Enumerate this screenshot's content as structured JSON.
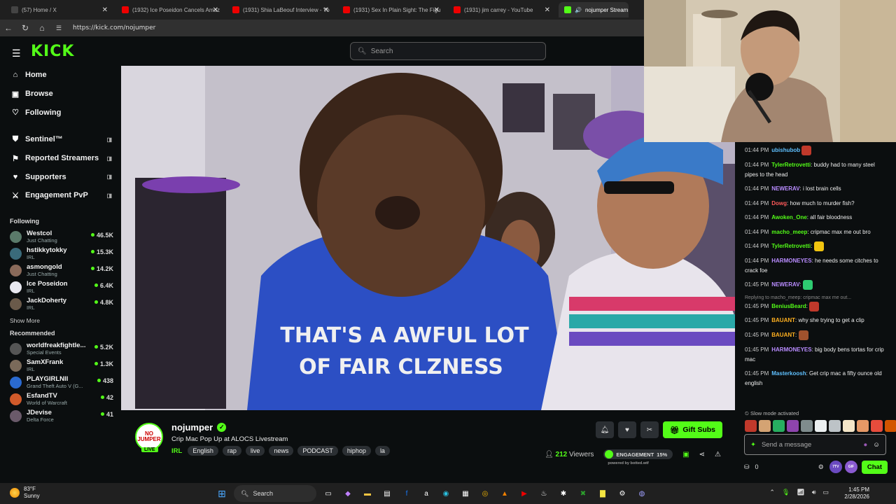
{
  "browser": {
    "tabs": [
      {
        "label": "(57) Home / X",
        "color": "#444"
      },
      {
        "label": "(1932) Ice Poseidon Cancels Amaz",
        "color": "#e00"
      },
      {
        "label": "(1931) Shia LaBeouf Interview - Yo",
        "color": "#e00"
      },
      {
        "label": "(1931) Sex In Plain Sight: The Figu",
        "color": "#e00"
      },
      {
        "label": "(1931) jim carrey - YouTube",
        "color": "#e00"
      }
    ],
    "active_tab": "nojumper Stream",
    "url": "https://kick.com/nojumper"
  },
  "header": {
    "logo": "KICK",
    "search_placeholder": "Search"
  },
  "sidebar": {
    "nav": [
      {
        "label": "Home",
        "icon": "⌂"
      },
      {
        "label": "Browse",
        "icon": "▣"
      },
      {
        "label": "Following",
        "icon": "♡"
      }
    ],
    "extras": [
      {
        "label": "Sentinel™",
        "icon": "⛊"
      },
      {
        "label": "Reported Streamers",
        "icon": "⚑"
      },
      {
        "label": "Supporters",
        "icon": "♥"
      },
      {
        "label": "Engagement PvP",
        "icon": "⚔"
      }
    ],
    "following_title": "Following",
    "following": [
      {
        "name": "Westcol",
        "category": "Just Chatting",
        "viewers": "46.5K",
        "color": "#5a7a6a"
      },
      {
        "name": "hstikkytokky",
        "category": "IRL",
        "viewers": "15.3K",
        "color": "#3a6a7a"
      },
      {
        "name": "asmongold",
        "category": "Just Chatting",
        "viewers": "14.2K",
        "color": "#8a6a5a"
      },
      {
        "name": "Ice Poseidon",
        "category": "IRL",
        "viewers": "6.4K",
        "color": "#e8e8f0"
      },
      {
        "name": "JackDoherty",
        "category": "IRL",
        "viewers": "4.8K",
        "color": "#6a5a4a"
      }
    ],
    "show_more": "Show More",
    "recommended_title": "Recommended",
    "recommended": [
      {
        "name": "worldfreakfightle...",
        "category": "Special Events",
        "viewers": "5.2K",
        "color": "#555"
      },
      {
        "name": "SamXFrank",
        "category": "IRL",
        "viewers": "1.3K",
        "color": "#7a6a5a"
      },
      {
        "name": "PLAYGIRLNII",
        "category": "Grand Theft Auto V (G...",
        "viewers": "438",
        "color": "#2a6ad0"
      },
      {
        "name": "EsfandTV",
        "category": "World of Warcraft",
        "viewers": "42",
        "color": "#d05a2a"
      },
      {
        "name": "JDevise",
        "category": "Delta Force",
        "viewers": "41",
        "color": "#6a5a6a"
      }
    ]
  },
  "stream": {
    "channel": "nojumper",
    "avatar_text": "NO JUMPER",
    "live": "LIVE",
    "title": "Crip Mac Pop Up at ALOCS Livestream",
    "category": "IRL",
    "tags": [
      "English",
      "rap",
      "live",
      "news",
      "PODCAST",
      "hiphop",
      "la"
    ],
    "gift_label": "Gift Subs",
    "viewers": "212",
    "viewers_label": "Viewers",
    "engagement_label": "ENGAGEMENT",
    "engagement_value": "15%",
    "engagement_fraction": 0.15,
    "powered_by": "powered by botted.wtf",
    "shirt_text_1": "THAT'S A AWFUL LOT",
    "shirt_text_2": "OF FAIR CLZNESS"
  },
  "chat": {
    "messages": [
      {
        "time": "01:44 PM",
        "user": "ubishubob",
        "text": "",
        "color": "#5fc0ff",
        "emote": "#c0392b"
      },
      {
        "time": "01:44 PM",
        "user": "TylerRetrovetti",
        "text": ": buddy had to many steel pipes to the head",
        "color": "#53fc18"
      },
      {
        "time": "01:44 PM",
        "user": "NEWERAV",
        "text": ": i lost brain cells",
        "color": "#b98cff"
      },
      {
        "time": "01:44 PM",
        "user": "Dowg",
        "text": ": how much to murder fish?",
        "color": "#ff5a5a"
      },
      {
        "time": "01:44 PM",
        "user": "Awoken_One",
        "text": ": all fair bloodness",
        "color": "#53fc18"
      },
      {
        "time": "01:44 PM",
        "user": "macho_meep",
        "text": ": cripmac max me out bro",
        "color": "#53fc18"
      },
      {
        "time": "01:44 PM",
        "user": "TylerRetrovetti",
        "text": ":",
        "color": "#53fc18",
        "emote": "#f1c40f"
      },
      {
        "time": "01:44 PM",
        "user": "HARMONEYES",
        "text": ": he needs some citches to crack foe",
        "color": "#b98cff"
      },
      {
        "time": "01:45 PM",
        "user": "NEWERAV",
        "text": ":",
        "color": "#b98cff",
        "emote": "#2ecc71"
      },
      {
        "time": "01:45 PM",
        "user": "BeniusBeard",
        "text": ":",
        "color": "#53fc18",
        "emote": "#c0392b",
        "reply": "Replying to macho_meep: cripmac max me out..."
      },
      {
        "time": "01:45 PM",
        "user": "BAUANT",
        "text": ": why she trying to get a clip",
        "color": "#ffb020"
      },
      {
        "time": "01:45 PM",
        "user": "BAUANT",
        "text": ":",
        "color": "#ffb020",
        "emote": "#a0522d"
      },
      {
        "time": "01:45 PM",
        "user": "HARMONEYES",
        "text": ": big body bens tortas for crip mac",
        "color": "#b98cff"
      },
      {
        "time": "01:45 PM",
        "user": "Masterkoosh",
        "text": ": Get crip mac a fifty ounce old english",
        "color": "#5fc0ff"
      }
    ],
    "slow_mode": "Slow mode activated",
    "input_placeholder": "Send a message",
    "points": "0",
    "chat_button": "Chat",
    "badge_1": "7TV",
    "badge_2": "GIF"
  },
  "taskbar": {
    "temp": "83°F",
    "condition": "Sunny",
    "search": "Search",
    "time": "1:45 PM",
    "date": "2/28/2026"
  }
}
